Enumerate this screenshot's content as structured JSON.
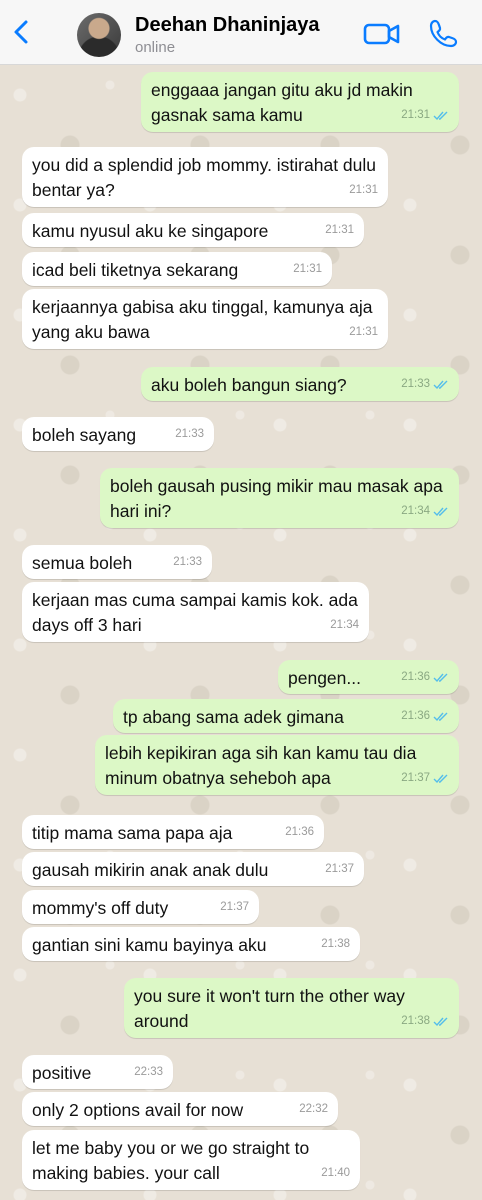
{
  "header": {
    "contact_name": "Deehan Dhaninjaya",
    "status": "online"
  },
  "colors": {
    "accent": "#0a7cff",
    "outgoing_bubble": "#dcf8c6",
    "incoming_bubble": "#ffffff",
    "read_ticks": "#53bdeb"
  },
  "messages": [
    {
      "dir": "out",
      "text": "enggaaa jangan gitu aku jd makin gasnak sama kamu",
      "time": "21:31"
    },
    {
      "dir": "in",
      "text": "you did a splendid job mommy. istirahat dulu bentar ya?",
      "time": "21:31"
    },
    {
      "dir": "in",
      "text": "kamu nyusul aku ke singapore",
      "time": "21:31"
    },
    {
      "dir": "in",
      "text": "icad beli tiketnya sekarang",
      "time": "21:31"
    },
    {
      "dir": "in",
      "text": "kerjaannya gabisa aku tinggal, kamunya aja yang aku bawa",
      "time": "21:31"
    },
    {
      "dir": "out",
      "text": "aku boleh bangun siang?",
      "time": "21:33"
    },
    {
      "dir": "in",
      "text": "boleh sayang",
      "time": "21:33"
    },
    {
      "dir": "out",
      "text": "boleh gausah pusing mikir mau masak apa hari ini?",
      "time": "21:34"
    },
    {
      "dir": "in",
      "text": "semua boleh",
      "time": "21:33"
    },
    {
      "dir": "in",
      "text": "kerjaan mas cuma sampai kamis kok. ada days off 3 hari",
      "time": "21:34"
    },
    {
      "dir": "out",
      "text": "pengen...",
      "time": "21:36"
    },
    {
      "dir": "out",
      "text": "tp abang sama adek gimana",
      "time": "21:36"
    },
    {
      "dir": "out",
      "text": "lebih kepikiran aga sih kan kamu tau dia minum obatnya seheboh apa",
      "time": "21:37"
    },
    {
      "dir": "in",
      "text": "titip mama sama papa aja",
      "time": "21:36"
    },
    {
      "dir": "in",
      "text": "gausah mikirin anak anak dulu",
      "time": "21:37"
    },
    {
      "dir": "in",
      "text": "mommy's off duty",
      "time": "21:37"
    },
    {
      "dir": "in",
      "text": "gantian sini kamu bayinya aku",
      "time": "21:38"
    },
    {
      "dir": "out",
      "text": "you sure it won't turn the other way around",
      "time": "21:38"
    },
    {
      "dir": "in",
      "text": "positive",
      "time": "22:33"
    },
    {
      "dir": "in",
      "text": "only 2 options avail for now",
      "time": "22:32"
    },
    {
      "dir": "in",
      "text": "let me baby you or we go straight to making babies. your call",
      "time": "21:40"
    }
  ]
}
